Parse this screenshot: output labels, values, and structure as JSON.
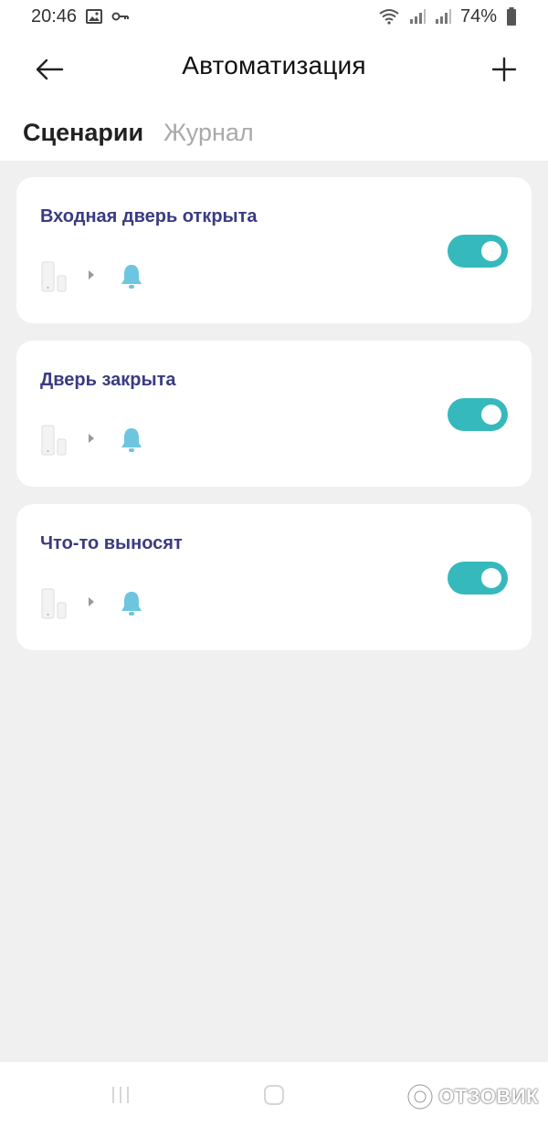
{
  "status_bar": {
    "time": "20:46",
    "battery": "74%"
  },
  "header": {
    "title": "Автоматизация"
  },
  "tabs": [
    {
      "label": "Сценарии",
      "active": true
    },
    {
      "label": "Журнал",
      "active": false
    }
  ],
  "scenarios": [
    {
      "name": "Входная дверь открыта",
      "enabled": true
    },
    {
      "name": "Дверь закрыта",
      "enabled": true
    },
    {
      "name": "Что-то выносят",
      "enabled": true
    }
  ],
  "colors": {
    "accent": "#35b9bd",
    "title": "#3b3b82",
    "bell": "#6ec5e0"
  },
  "watermark": {
    "text": "ОТЗОВИК"
  }
}
